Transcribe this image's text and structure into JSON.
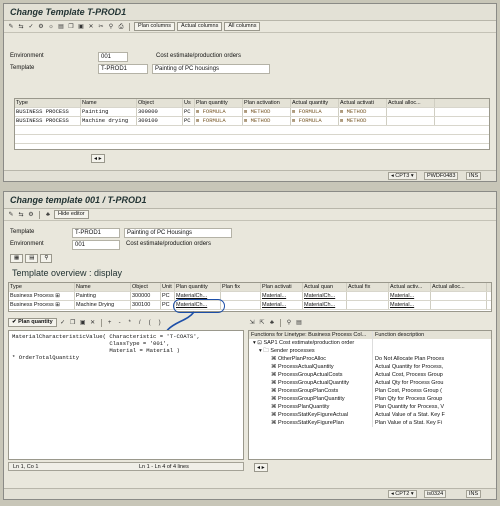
{
  "window1": {
    "title": "Change Template T-PROD1",
    "toolbar_buttons": [
      "Plan columns",
      "Actual columns",
      "All columns"
    ],
    "environment_label": "Environment",
    "environment_value": "001",
    "environment_desc": "Cost estimate/production orders",
    "template_label": "Template",
    "template_value": "T-PROD1",
    "template_desc": "Painting of PC housings",
    "table_headers": [
      "Type",
      "Name",
      "Object",
      "Us",
      "Plan quantity",
      "Plan activation",
      "Actual quantity",
      "Actual activati",
      "Actual alloc..."
    ],
    "rows": [
      [
        "BUSINESS PROCESS",
        "Painting",
        "300000",
        "PC",
        "FORMULA",
        "METHOD",
        "FORMULA",
        "METHOD",
        ""
      ],
      [
        "BUSINESS PROCESS",
        "Machine drying",
        "300100",
        "PC",
        "FORMULA",
        "METHOD",
        "FORMULA",
        "METHOD",
        ""
      ]
    ],
    "status": {
      "system": "CPT3",
      "server": "PWDF0483",
      "mode": "INS"
    }
  },
  "window2": {
    "title": "Change template 001 / T-PROD1",
    "hide_editor_label": "Hide editor",
    "template_label": "Template",
    "template_value": "T-PROD1",
    "template_desc": "Painting of PC Housings",
    "environment_label": "Environment",
    "environment_value": "001",
    "environment_desc": "Cost estimate/production orders",
    "overview_title": "Template overview : display",
    "table_headers": [
      "Type",
      "Name",
      "Object",
      "Unit",
      "Plan quantity",
      "Plan fix",
      "Plan activati",
      "Actual quan",
      "Actual fix",
      "Actual activ...",
      "Actual alloc..."
    ],
    "rows": [
      [
        "Business Process",
        "Painting",
        "300000",
        "PC",
        "MaterialCh...",
        "",
        "Material...",
        "MaterialCh...",
        "",
        "Material...",
        ""
      ],
      [
        "Business Process",
        "Machine Drying",
        "300100",
        "PC",
        "MaterialCh...",
        "",
        "Material...",
        "MaterialCh...",
        "",
        "Material...",
        ""
      ]
    ],
    "editor_tab_label": "Plan quantity",
    "editor_lines": [
      "MaterialCharacteristicValue( Characteristic = 'T-COATS',",
      "                             ClassType = '001',",
      "                             Material = Material )",
      "* OrderTotalQuantity"
    ],
    "editor_status": {
      "position": "Ln 1, Co 1",
      "range": "Ln 1 - Ln 4 of 4 lines"
    },
    "functions_header": "Functions for Linetype: Business Process Col...",
    "functions_desc_header": "Function description",
    "functions": [
      {
        "name": "SAP1 Cost estimate/production order",
        "desc": ""
      },
      {
        "name": "Sender processes",
        "desc": ""
      },
      {
        "name": "OtherPlanProcAlloc",
        "desc": "Do Not Allocate Plan Proces"
      },
      {
        "name": "ProcessActualQuantity",
        "desc": "Actual Quantity for Process,"
      },
      {
        "name": "ProcessGroupActualCosts",
        "desc": "Actual Cost, Process Group"
      },
      {
        "name": "ProcessGroupActualQuantity",
        "desc": "Actual Qty for Process Grou"
      },
      {
        "name": "ProcessGroupPlanCosts",
        "desc": "Plan Cost, Process Group ("
      },
      {
        "name": "ProcessGroupPlanQuantity",
        "desc": "Plan Qty for Process Group"
      },
      {
        "name": "ProcessPlanQuantity",
        "desc": "Plan Quantity for Process, V"
      },
      {
        "name": "ProcessStatKeyFigureActual",
        "desc": "Actual Value of a Stat. Key F"
      },
      {
        "name": "ProcessStatKeyFigurePlan",
        "desc": "Plan Value of a Stat. Key Fi"
      }
    ],
    "status": {
      "system": "CPT2",
      "server": "is0324",
      "mode": "INS"
    }
  }
}
